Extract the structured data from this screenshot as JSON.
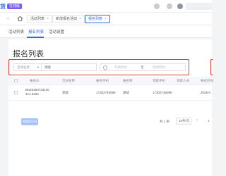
{
  "header": {
    "brand": "货",
    "badge": "在线版",
    "icons": [
      "user-icon",
      "settings-icon",
      "bell-icon"
    ]
  },
  "nav": {
    "prev_arrow": "‹",
    "tabs": [
      {
        "label": "活动列表",
        "active": false
      },
      {
        "label": "新增报名活动",
        "active": false
      },
      {
        "label": "报名列表",
        "active": true
      }
    ],
    "close": "×"
  },
  "subtabs": [
    {
      "label": "活动列表",
      "active": false
    },
    {
      "label": "报名列表",
      "active": true
    },
    {
      "label": "活动设置",
      "active": false
    }
  ],
  "main": {
    "title": "报名列表",
    "filter": {
      "select_label": "活动名称",
      "select_caret": "▾",
      "input_value": "测试",
      "date_start_placeholder": "开始时间",
      "date_separator": "至",
      "date_end_placeholder": "结束时间"
    },
    "table": {
      "headers": [
        "报名ID",
        "活动名称",
        "报名手机",
        "报名称",
        "领取手机",
        "领取人员",
        "报名时间"
      ],
      "rows": [
        {
          "id": "BN20250723100314 5426",
          "activity": "测试",
          "phone": "17302749095",
          "name": "测试",
          "receive_phone": "17302749095",
          "receiver": "",
          "time": "2025-0"
        }
      ]
    },
    "export_label": "导出Excel",
    "pager": {
      "total": "共 1 条",
      "page_size": "10条/页",
      "current_page": "1"
    }
  }
}
